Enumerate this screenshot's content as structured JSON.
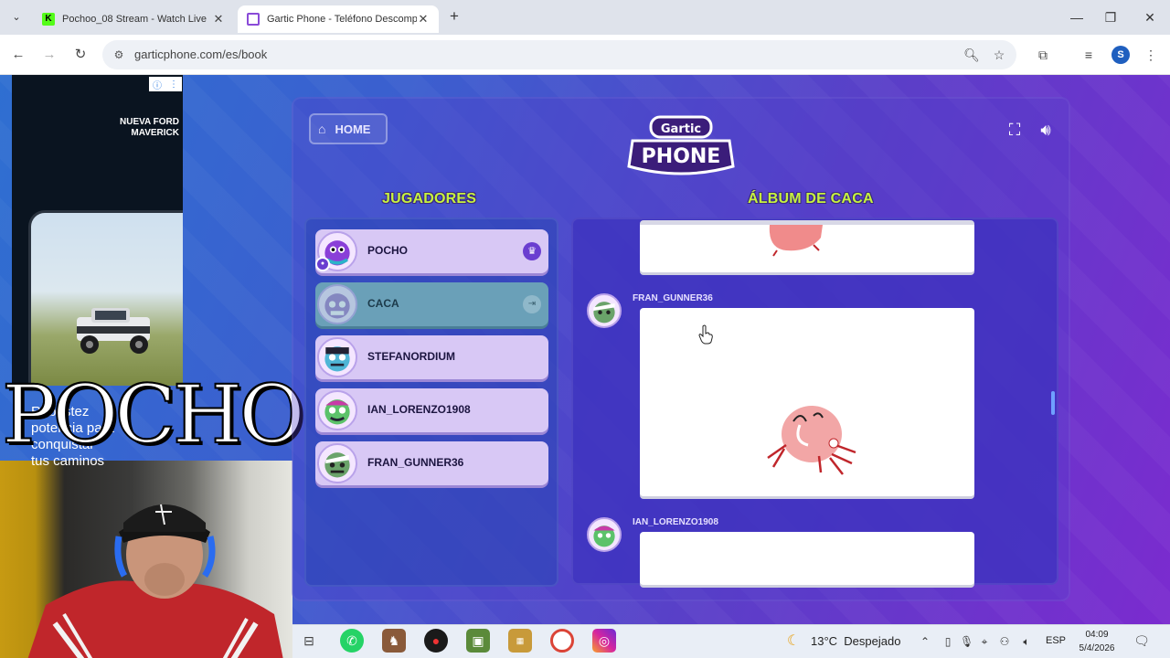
{
  "browser": {
    "tabs": [
      {
        "title": "Pochoo_08 Stream - Watch Live",
        "favicon": "kick-logo-icon",
        "active": false
      },
      {
        "title": "Gartic Phone - Teléfono Descompuesto",
        "favicon": "gartic-phone-icon",
        "active": true
      }
    ],
    "url": "garticphone.com/es/book",
    "profile_initial": "S"
  },
  "ad": {
    "headline": "NUEVA FORD\nMAVERICK",
    "overlay_text": "Robustez\npotencia para\nconquistar\ntus caminos"
  },
  "stream_overlay": {
    "name": "POCHO"
  },
  "game": {
    "home_label": "HOME",
    "logo_small": "Gartic",
    "logo_big": "PHONE",
    "players_title": "JUGADORES",
    "album_title": "ÁLBUM DE CACA",
    "players": [
      {
        "name": "POCHO",
        "status": "host"
      },
      {
        "name": "CACA",
        "status": "away"
      },
      {
        "name": "STEFANORDIUM",
        "status": "active"
      },
      {
        "name": "IAN_LORENZO1908",
        "status": "active"
      },
      {
        "name": "FRAN_GUNNER36",
        "status": "active"
      }
    ],
    "album_entries": [
      {
        "author": "FRAN_GUNNER36"
      },
      {
        "author": "IAN_LORENZO1908"
      }
    ]
  },
  "taskbar": {
    "weather_temp": "13°C",
    "weather_desc": "Despejado",
    "language": "ESP",
    "time": "04:09",
    "date": "5/4/2026"
  },
  "colors": {
    "section_title": "#c7f23e",
    "player_card": "#d8c8f5",
    "away_card": "#6aa0b8",
    "host_crown": "#6a3ed0"
  }
}
